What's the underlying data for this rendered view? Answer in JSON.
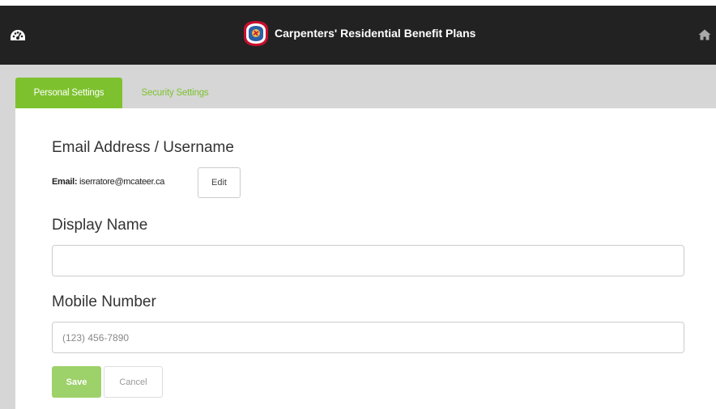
{
  "header": {
    "brand_title": "Carpenters' Residential Benefit Plans",
    "left_icon": "dashboard-icon",
    "right_icon": "home-icon",
    "background": "#222222"
  },
  "tabs": [
    {
      "label": "Personal Settings",
      "active": true
    },
    {
      "label": "Security Settings",
      "active": false
    }
  ],
  "accent_color": "#7dc22e",
  "email_section": {
    "heading": "Email Address / Username",
    "label": "Email:",
    "value": "iserratore@mcateer.ca",
    "edit_label": "Edit"
  },
  "display_name_section": {
    "heading": "Display Name",
    "value": "",
    "placeholder": ""
  },
  "mobile_section": {
    "heading": "Mobile Number",
    "value": "",
    "placeholder": "(123) 456-7890"
  },
  "actions": {
    "save_label": "Save",
    "cancel_label": "Cancel"
  }
}
